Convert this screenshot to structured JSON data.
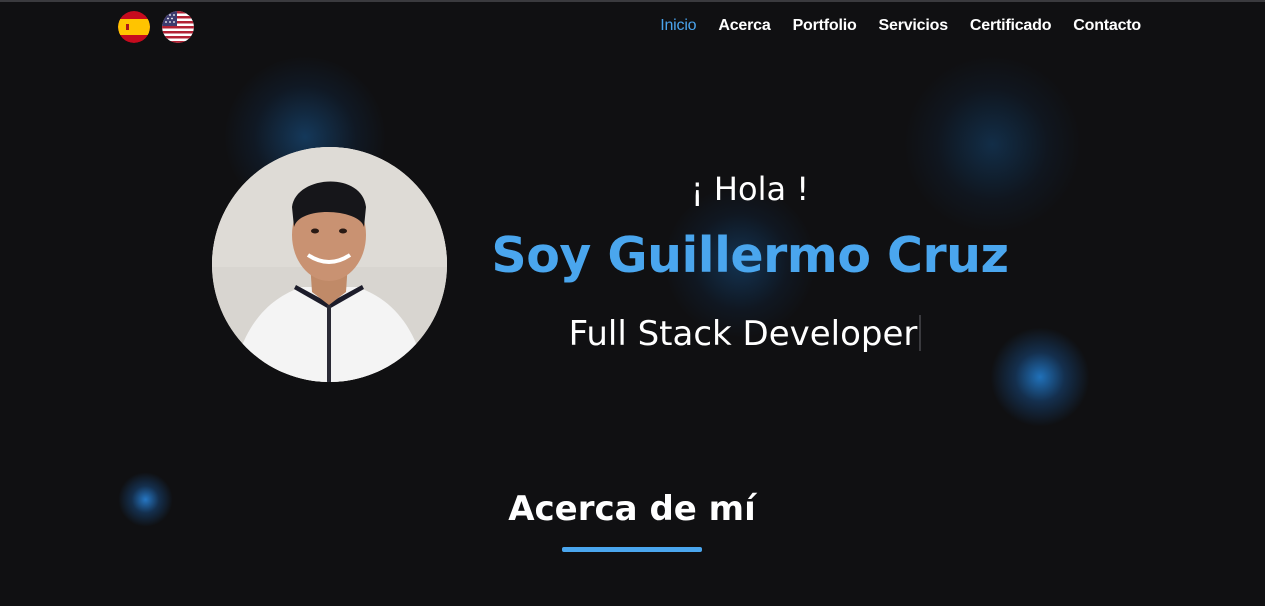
{
  "languages": [
    {
      "code": "es",
      "icon": "spain-flag-icon"
    },
    {
      "code": "us",
      "icon": "usa-flag-icon"
    }
  ],
  "nav": {
    "items": [
      {
        "label": "Inicio",
        "active": true
      },
      {
        "label": "Acerca"
      },
      {
        "label": "Portfolio"
      },
      {
        "label": "Servicios"
      },
      {
        "label": "Certificado"
      },
      {
        "label": "Contacto"
      }
    ]
  },
  "hero": {
    "greeting": "¡ Hola !",
    "name": "Soy Guillermo Cruz",
    "role": "Full Stack Developer"
  },
  "about": {
    "title": "Acerca de mí"
  },
  "colors": {
    "background": "#101012",
    "accent": "#4aa6ee",
    "text": "#ffffff"
  }
}
